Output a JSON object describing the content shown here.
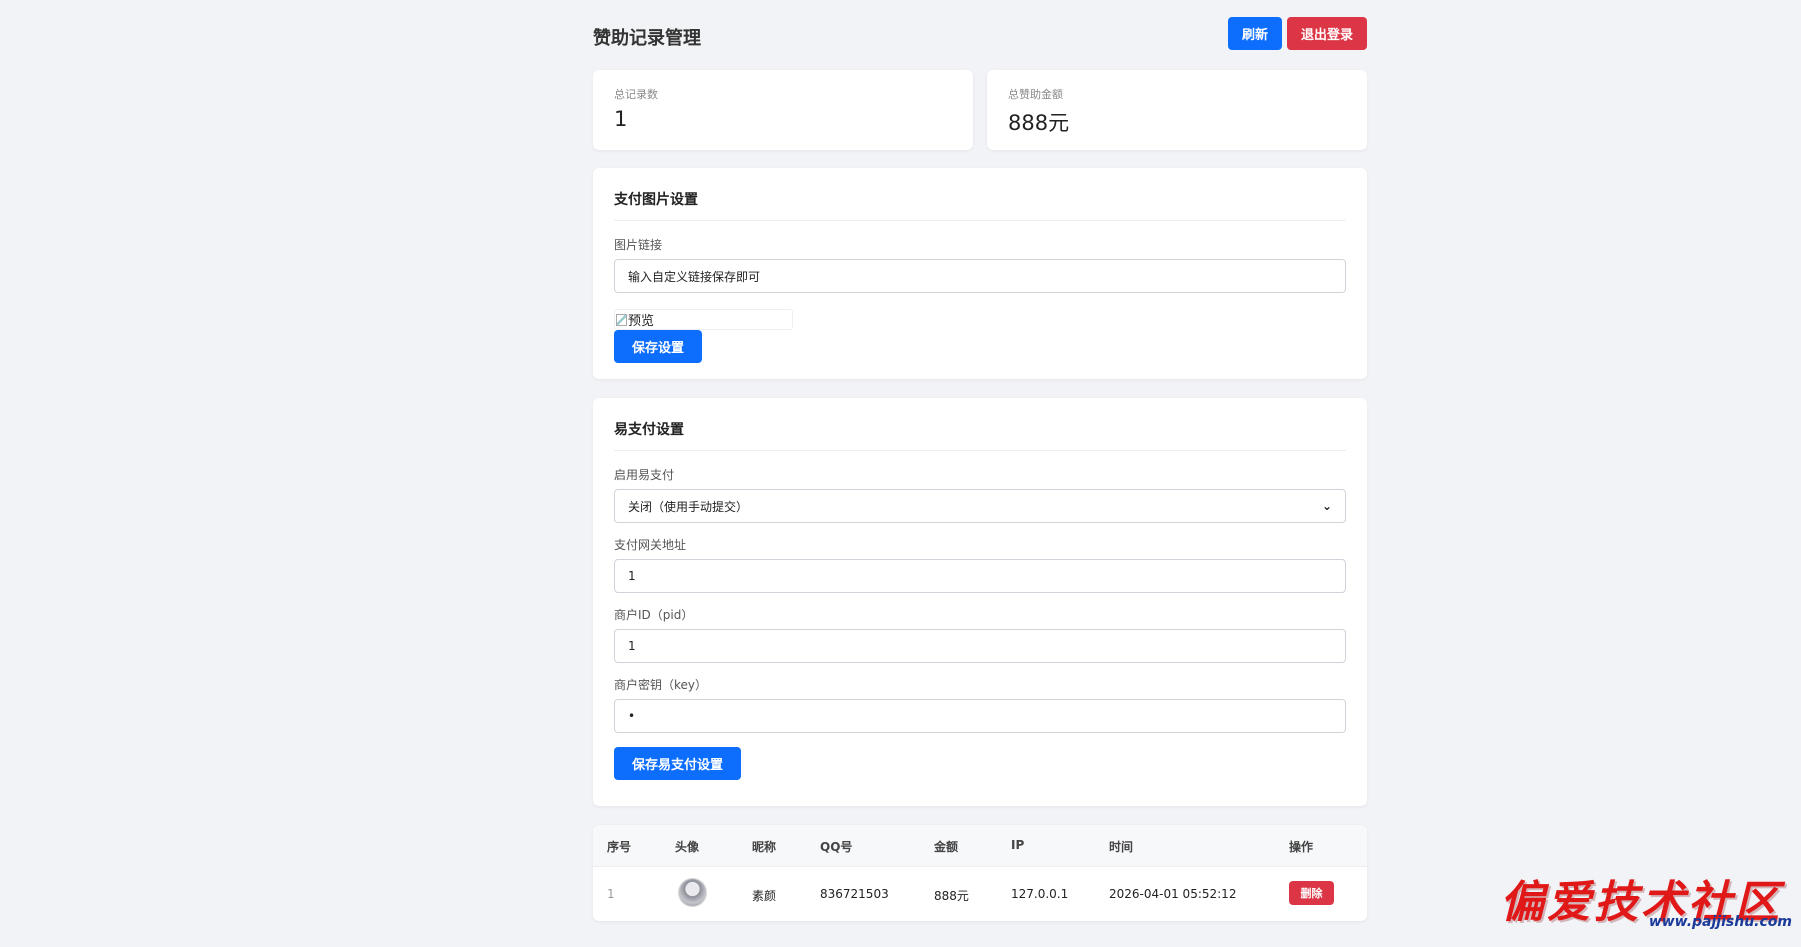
{
  "header": {
    "title": "赞助记录管理",
    "refresh_label": "刷新",
    "logout_label": "退出登录"
  },
  "stats": {
    "total_records_label": "总记录数",
    "total_records_value": "1",
    "total_amount_label": "总赞助金额",
    "total_amount_value": "888元"
  },
  "image_settings": {
    "title": "支付图片设置",
    "link_label": "图片链接",
    "link_value": "输入自定义链接保存即可",
    "preview_alt": "预览",
    "save_label": "保存设置"
  },
  "epay_settings": {
    "title": "易支付设置",
    "enable_label": "启用易支付",
    "enable_selected": "关闭（使用手动提交）",
    "gateway_label": "支付网关地址",
    "gateway_value": "1",
    "pid_label": "商户ID（pid）",
    "pid_value": "1",
    "key_label": "商户密钥（key）",
    "key_value": "•",
    "save_label": "保存易支付设置"
  },
  "table": {
    "headers": [
      "序号",
      "头像",
      "昵称",
      "QQ号",
      "金额",
      "IP",
      "时间",
      "操作"
    ],
    "rows": [
      {
        "index": "1",
        "nickname": "素颜",
        "qq": "836721503",
        "amount": "888元",
        "ip": "127.0.0.1",
        "time": "2026-04-01 05:52:12",
        "delete_label": "删除"
      }
    ]
  },
  "watermark": {
    "text": "偏爱技术社区",
    "url": "www.pajjishu.com"
  },
  "colors": {
    "primary": "#0d6efd",
    "danger": "#dc3545",
    "background": "#f2f3f7",
    "watermark_red": "#e01818"
  }
}
